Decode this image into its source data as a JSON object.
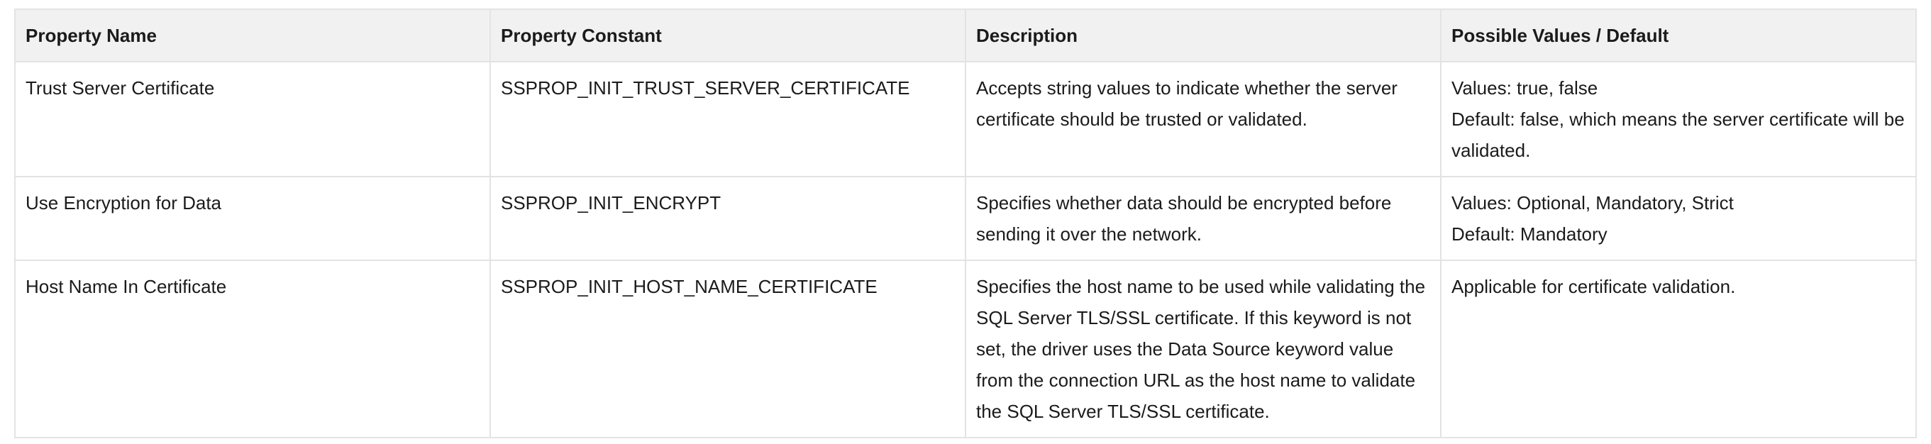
{
  "table": {
    "headers": [
      "Property Name",
      "Property Constant",
      "Description",
      "Possible Values / Default"
    ],
    "rows": [
      {
        "name": "Trust Server Certificate",
        "constant": "SSPROP_INIT_TRUST_SERVER_CERTIFICATE",
        "description": "Accepts string values to indicate whether the server certificate should be trusted or validated.",
        "values_line1": "Values: true, false",
        "values_line2": "Default: false, which means the server certificate will be validated."
      },
      {
        "name": "Use Encryption for Data",
        "constant": "SSPROP_INIT_ENCRYPT",
        "description": "Specifies whether data should be encrypted before sending it over the network.",
        "values_line1": "Values: Optional, Mandatory, Strict",
        "values_line2": "Default: Mandatory"
      },
      {
        "name": "Host Name In Certificate",
        "constant": "SSPROP_INIT_HOST_NAME_CERTIFICATE",
        "description": "Specifies the host name to be used while validating the SQL Server TLS/SSL certificate. If this keyword is not set, the driver uses the Data Source keyword value from the connection URL as the host name to validate the SQL Server TLS/SSL certificate.",
        "values_line1": "Applicable for certificate validation."
      }
    ]
  }
}
